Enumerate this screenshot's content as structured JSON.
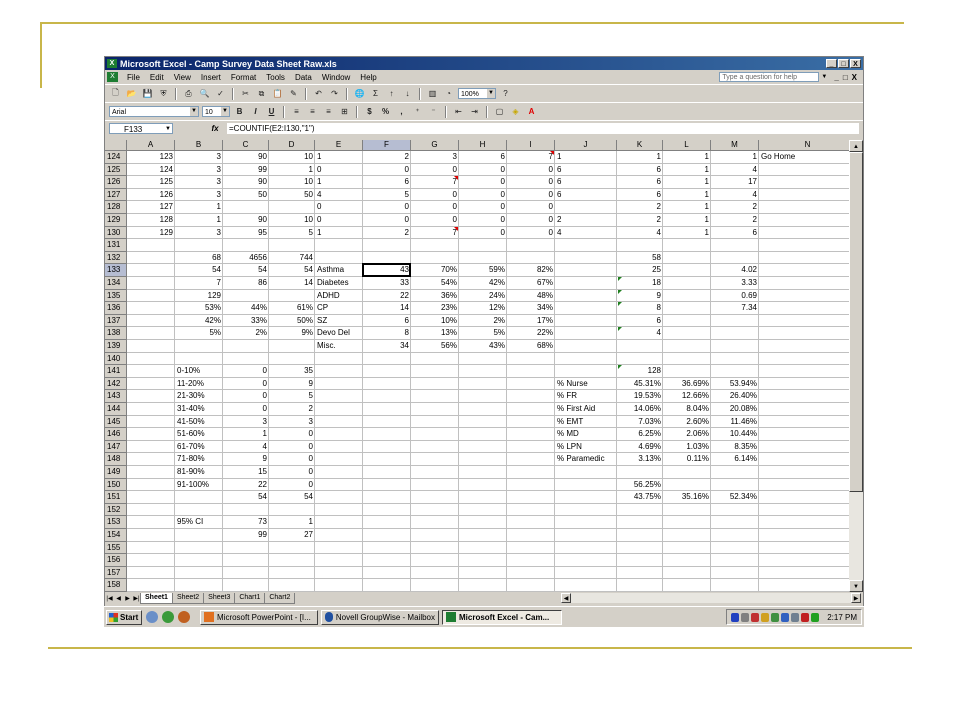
{
  "window": {
    "title": "Microsoft Excel - Camp Survey Data Sheet Raw.xls",
    "buttons": [
      "_",
      "□",
      "X"
    ]
  },
  "menu": {
    "items": [
      "File",
      "Edit",
      "View",
      "Insert",
      "Format",
      "Tools",
      "Data",
      "Window",
      "Help"
    ],
    "ask_placeholder": "Type a question for help",
    "doc_buttons": [
      "_",
      "□",
      "X"
    ]
  },
  "toolbar": {
    "zoom": "100%",
    "font": "Arial",
    "size": "10",
    "bold": "B",
    "italic": "I",
    "underline": "U",
    "currency": "$",
    "percent": "%",
    "comma": ",",
    "sum": "Σ"
  },
  "formula_bar": {
    "name_box": "F133",
    "fx": "fx",
    "formula": "=COUNTIF(E2:I130,\"1\")"
  },
  "columns": [
    "A",
    "B",
    "C",
    "D",
    "E",
    "F",
    "G",
    "H",
    "I",
    "J",
    "K",
    "L",
    "M",
    "N"
  ],
  "selected_column": "F",
  "selected_row": "133",
  "rows": [
    {
      "n": "124",
      "cells": {
        "A": "123",
        "B": "3",
        "C": "90",
        "D": "10",
        "E": "1",
        "F": "2",
        "G": "3",
        "H": "6",
        "I": "7",
        "J": "1",
        "K": "1",
        "L": "1",
        "M": "1",
        "N": "Go Home"
      }
    },
    {
      "n": "125",
      "cells": {
        "A": "124",
        "B": "3",
        "C": "99",
        "D": "1",
        "E": "0",
        "F": "0",
        "G": "0",
        "H": "0",
        "I": "0",
        "J": "6",
        "K": "6",
        "L": "1",
        "M": "4"
      }
    },
    {
      "n": "126",
      "cells": {
        "A": "125",
        "B": "3",
        "C": "90",
        "D": "10",
        "E": "1",
        "F": "6",
        "G": "7",
        "H": "0",
        "I": "0",
        "J": "6",
        "K": "6",
        "L": "1",
        "M": "17"
      }
    },
    {
      "n": "127",
      "cells": {
        "A": "126",
        "B": "3",
        "C": "50",
        "D": "50",
        "E": "4",
        "F": "5",
        "G": "0",
        "H": "0",
        "I": "0",
        "J": "6",
        "K": "6",
        "L": "1",
        "M": "4"
      }
    },
    {
      "n": "128",
      "cells": {
        "A": "127",
        "B": "1",
        "E": "0",
        "F": "0",
        "G": "0",
        "H": "0",
        "I": "0",
        "K": "2",
        "L": "1",
        "M": "2"
      }
    },
    {
      "n": "129",
      "cells": {
        "A": "128",
        "B": "1",
        "C": "90",
        "D": "10",
        "E": "0",
        "F": "0",
        "G": "0",
        "H": "0",
        "I": "0",
        "J": "2",
        "K": "2",
        "L": "1",
        "M": "2"
      }
    },
    {
      "n": "130",
      "cells": {
        "A": "129",
        "B": "3",
        "C": "95",
        "D": "5",
        "E": "1",
        "F": "2",
        "G": "7",
        "H": "0",
        "I": "0",
        "J": "4",
        "K": "4",
        "L": "1",
        "M": "6"
      }
    },
    {
      "n": "131",
      "cells": {}
    },
    {
      "n": "132",
      "cells": {
        "B": "68",
        "C": "4656",
        "D": "744",
        "K": "58"
      }
    },
    {
      "n": "133",
      "cells": {
        "B": "54",
        "C": "54",
        "D": "54",
        "E": "Asthma",
        "F": "43",
        "G": "70%",
        "H": "59%",
        "I": "82%",
        "K": "25",
        "M": "4.02"
      }
    },
    {
      "n": "134",
      "cells": {
        "B": "7",
        "C": "86",
        "D": "14",
        "E": "Diabetes",
        "F": "33",
        "G": "54%",
        "H": "42%",
        "I": "67%",
        "K": "18",
        "M": "3.33"
      }
    },
    {
      "n": "135",
      "cells": {
        "B": "129",
        "E": "ADHD",
        "F": "22",
        "G": "36%",
        "H": "24%",
        "I": "48%",
        "K": "9",
        "M": "0.69"
      }
    },
    {
      "n": "136",
      "cells": {
        "B": "53%",
        "C": "44%",
        "D": "61%",
        "E": "CP",
        "F": "14",
        "G": "23%",
        "H": "12%",
        "I": "34%",
        "K": "8",
        "M": "7.34"
      }
    },
    {
      "n": "137",
      "cells": {
        "B": "42%",
        "C": "33%",
        "D": "50%",
        "E": "SZ",
        "F": "6",
        "G": "10%",
        "H": "2%",
        "I": "17%",
        "K": "6"
      }
    },
    {
      "n": "138",
      "cells": {
        "B": "5%",
        "C": "2%",
        "D": "9%",
        "E": "Devo Del",
        "F": "8",
        "G": "13%",
        "H": "5%",
        "I": "22%",
        "K": "4"
      }
    },
    {
      "n": "139",
      "cells": {
        "E": "Misc.",
        "F": "34",
        "G": "56%",
        "H": "43%",
        "I": "68%"
      }
    },
    {
      "n": "140",
      "cells": {}
    },
    {
      "n": "141",
      "cells": {
        "B": "0-10%",
        "C": "0",
        "D": "35",
        "K": "128"
      }
    },
    {
      "n": "142",
      "cells": {
        "B": "11-20%",
        "C": "0",
        "D": "9",
        "J": "% Nurse",
        "K": "45.31%",
        "L": "36.69%",
        "M": "53.94%"
      }
    },
    {
      "n": "143",
      "cells": {
        "B": "21-30%",
        "C": "0",
        "D": "5",
        "J": "% FR",
        "K": "19.53%",
        "L": "12.66%",
        "M": "26.40%"
      }
    },
    {
      "n": "144",
      "cells": {
        "B": "31-40%",
        "C": "0",
        "D": "2",
        "J": "% First Aid",
        "K": "14.06%",
        "L": "8.04%",
        "M": "20.08%"
      }
    },
    {
      "n": "145",
      "cells": {
        "B": "41-50%",
        "C": "3",
        "D": "3",
        "J": "% EMT",
        "K": "7.03%",
        "L": "2.60%",
        "M": "11.46%"
      }
    },
    {
      "n": "146",
      "cells": {
        "B": "51-60%",
        "C": "1",
        "D": "0",
        "J": "% MD",
        "K": "6.25%",
        "L": "2.06%",
        "M": "10.44%"
      }
    },
    {
      "n": "147",
      "cells": {
        "B": "61-70%",
        "C": "4",
        "D": "0",
        "J": "% LPN",
        "K": "4.69%",
        "L": "1.03%",
        "M": "8.35%"
      }
    },
    {
      "n": "148",
      "cells": {
        "B": "71-80%",
        "C": "9",
        "D": "0",
        "J": "% Paramedic",
        "K": "3.13%",
        "L": "0.11%",
        "M": "6.14%"
      }
    },
    {
      "n": "149",
      "cells": {
        "B": "81-90%",
        "C": "15",
        "D": "0"
      }
    },
    {
      "n": "150",
      "cells": {
        "B": "91-100%",
        "C": "22",
        "D": "0",
        "K": "56.25%"
      }
    },
    {
      "n": "151",
      "cells": {
        "C": "54",
        "D": "54",
        "K": "43.75%",
        "L": "35.16%",
        "M": "52.34%"
      }
    },
    {
      "n": "152",
      "cells": {}
    },
    {
      "n": "153",
      "cells": {
        "B": "95% CI",
        "C": "73",
        "D": "1"
      }
    },
    {
      "n": "154",
      "cells": {
        "C": "99",
        "D": "27"
      }
    },
    {
      "n": "155",
      "cells": {}
    },
    {
      "n": "156",
      "cells": {}
    },
    {
      "n": "157",
      "cells": {}
    },
    {
      "n": "158",
      "cells": {}
    }
  ],
  "sheet_tabs": [
    "Sheet1",
    "Sheet2",
    "Sheet3",
    "Chart1",
    "Chart2"
  ],
  "active_tab": "Sheet1",
  "taskbar": {
    "start": "Start",
    "buttons": [
      "Microsoft PowerPoint - [I...",
      "Novell GroupWise - Mailbox",
      "Microsoft Excel - Cam..."
    ],
    "active_button": 2,
    "clock": "2:17 PM"
  },
  "colors": {
    "slide_accent": "#c8b64a",
    "title_bar": "#0a246a",
    "selected_header": "#b6bdd2",
    "comment_marker": "#e00000",
    "error_marker": "#208020"
  }
}
